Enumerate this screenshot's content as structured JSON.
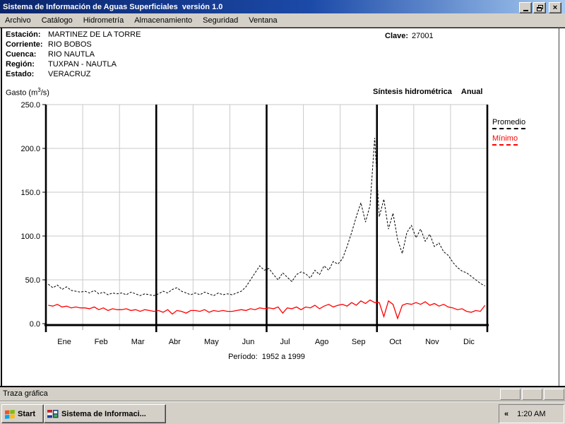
{
  "window": {
    "title": "Sistema de Información de Aguas Superficiales  versión 1.0",
    "control_icons": [
      "minimize-icon",
      "restore-icon",
      "close-icon"
    ]
  },
  "menu": {
    "items": [
      {
        "label": "Archivo"
      },
      {
        "label": "Catálogo"
      },
      {
        "label": "Hidrometría"
      },
      {
        "label": "Almacenamiento"
      },
      {
        "label": "Seguridad"
      },
      {
        "label": "Ventana"
      }
    ]
  },
  "station": {
    "rows": [
      {
        "label": "Estación:",
        "value": "MARTINEZ DE LA TORRE"
      },
      {
        "label": "Corriente:",
        "value": "RIO BOBOS"
      },
      {
        "label": "Cuenca:",
        "value": "RIO NAUTLA"
      },
      {
        "label": "Región:",
        "value": "TUXPAN - NAUTLA"
      },
      {
        "label": "Estado:",
        "value": "VERACRUZ"
      }
    ],
    "clave_label": "Clave:",
    "clave_value": "27001"
  },
  "chart_header": {
    "unit_prefix": "Gasto (m",
    "unit_sup": "3",
    "unit_suffix": "/s)",
    "title": "Síntesis hidrométrica",
    "subtitle": "Anual"
  },
  "legend": {
    "promedio": "Promedio",
    "minimo": "Mínimo",
    "promedio_color": "#000000",
    "minimo_color": "#ff0000"
  },
  "chart_data": {
    "type": "line",
    "title": "Síntesis hidrométrica Anual",
    "ylabel": "Gasto (m3/s)",
    "xlabel": "",
    "ylim": [
      0,
      250
    ],
    "yticks": [
      "0.0",
      "50.0",
      "100.0",
      "150.0",
      "200.0",
      "250.0"
    ],
    "months": [
      "Ene",
      "Feb",
      "Mar",
      "Abr",
      "May",
      "Jun",
      "Jul",
      "Ago",
      "Sep",
      "Oct",
      "Nov",
      "Dic"
    ],
    "quarter_line_every": 3,
    "grid": true,
    "legend_position": "right",
    "period_label": "Período:  1952 a 1999",
    "series": [
      {
        "name": "Promedio",
        "color": "#000000",
        "style": "dashed",
        "values": [
          45,
          41,
          44,
          39,
          42,
          38,
          37,
          36,
          37,
          35,
          38,
          34,
          36,
          33,
          35,
          34,
          35,
          33,
          36,
          34,
          32,
          34,
          33,
          32,
          34,
          37,
          35,
          39,
          41,
          37,
          35,
          33,
          35,
          33,
          36,
          34,
          32,
          35,
          33,
          34,
          33,
          35,
          37,
          42,
          50,
          58,
          66,
          61,
          63,
          56,
          50,
          58,
          53,
          48,
          56,
          59,
          57,
          52,
          61,
          56,
          66,
          61,
          71,
          68,
          74,
          88,
          104,
          122,
          138,
          116,
          135,
          212,
          122,
          142,
          108,
          126,
          96,
          80,
          104,
          112,
          98,
          108,
          94,
          102,
          88,
          92,
          82,
          78,
          70,
          64,
          60,
          58,
          54,
          50,
          46,
          43
        ]
      },
      {
        "name": "Mínimo",
        "color": "#ff0000",
        "style": "solid",
        "values": [
          21,
          20,
          22,
          19,
          20,
          18,
          19,
          18,
          18,
          17,
          19,
          16,
          18,
          15,
          17,
          16,
          16,
          17,
          15,
          16,
          14,
          16,
          15,
          14,
          15,
          13,
          16,
          11,
          15,
          14,
          12,
          15,
          15,
          14,
          16,
          13,
          15,
          14,
          15,
          14,
          14,
          15,
          16,
          15,
          17,
          16,
          18,
          17,
          18,
          17,
          19,
          12,
          18,
          17,
          19,
          16,
          19,
          18,
          21,
          17,
          20,
          22,
          19,
          21,
          22,
          20,
          24,
          21,
          26,
          23,
          27,
          24,
          24,
          8,
          26,
          22,
          6,
          21,
          23,
          22,
          24,
          22,
          25,
          21,
          23,
          20,
          22,
          19,
          18,
          16,
          17,
          14,
          13,
          15,
          14,
          21
        ]
      }
    ]
  },
  "statusbar": {
    "text": "Traza gráfica"
  },
  "taskbar": {
    "start_label": "Start",
    "task_label": "Sistema de Informaci...",
    "tray_chevron": "«",
    "clock": "1:20 AM"
  }
}
